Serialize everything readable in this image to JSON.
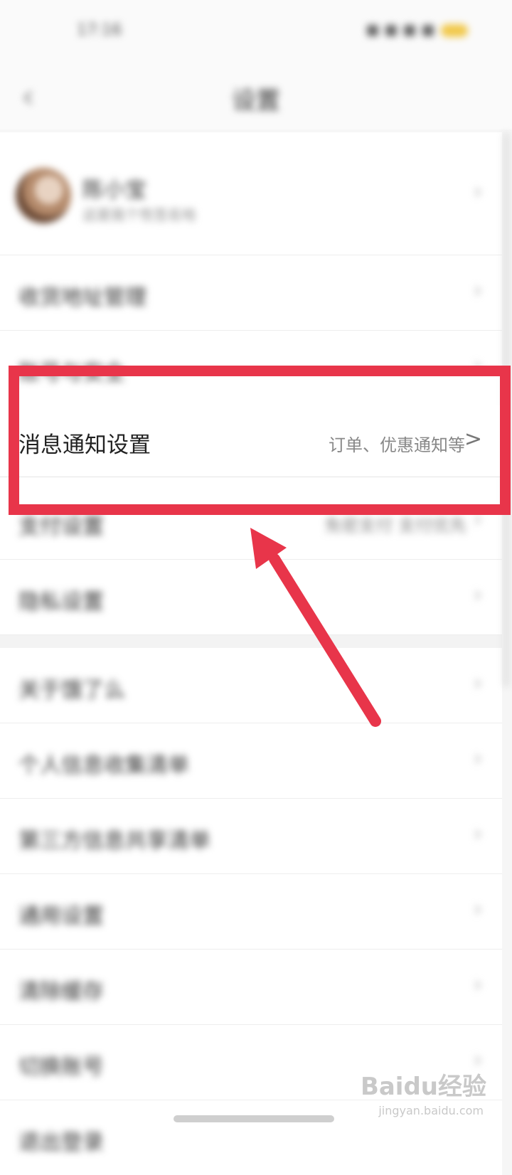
{
  "status_bar": {
    "time": "17:16"
  },
  "nav": {
    "title": "设置"
  },
  "profile": {
    "name": "陈小宝",
    "subtitle": "这是我个性签名哈"
  },
  "rows": [
    {
      "label": "收货地址管理"
    },
    {
      "label": "账号与安全"
    },
    {
      "label": "支付设置",
      "value": "免密支付   支付优先"
    },
    {
      "label": "隐私设置"
    },
    {
      "label": "关于饿了么"
    },
    {
      "label": "个人信息收集清单"
    },
    {
      "label": "第三方信息共享清单"
    },
    {
      "label": "通用设置"
    },
    {
      "label": "清除缓存",
      "value": ""
    },
    {
      "label": "切换账号"
    },
    {
      "label": "退出登录"
    }
  ],
  "highlight_row": {
    "label": "消息通知设置",
    "value": "订单、优惠通知等",
    "chevron": ">"
  },
  "watermark": {
    "brand": "Baidu经验",
    "url": "jingyan.baidu.com"
  },
  "colors": {
    "highlight_border": "#e8354a",
    "arrow": "#e8354a",
    "battery": "#f1c84b"
  },
  "icons": {
    "back": "chevron-left-icon",
    "row_chevron": "chevron-right-icon",
    "arrow": "pointer-arrow-icon"
  }
}
